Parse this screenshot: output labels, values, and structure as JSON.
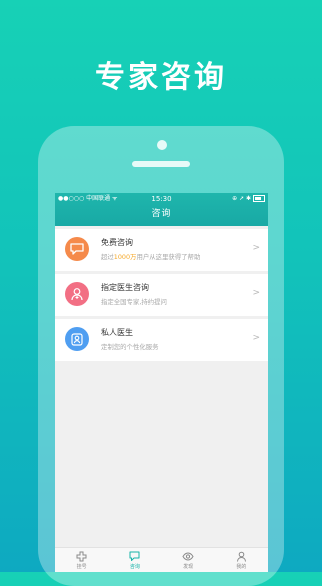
{
  "headline": "专家咨询",
  "status_bar": {
    "carrier": "●●○○○ 中国联通 ᯤ",
    "time": "15:30",
    "right_icons": "⊕ ➚ ✱"
  },
  "nav": {
    "title": "咨询"
  },
  "items": [
    {
      "title": "免费咨询",
      "sub_prefix": "超过",
      "sub_highlight": "1000万",
      "sub_suffix": "用户从这里获得了帮助",
      "icon": "chat-bubble-icon",
      "color": "#f58a4b"
    },
    {
      "title": "指定医生咨询",
      "subtitle": "指定全国专家,持约提问",
      "icon": "doctor-icon",
      "color": "#f26f84"
    },
    {
      "title": "私人医生",
      "subtitle": "定制您的个性化服务",
      "icon": "private-doctor-icon",
      "color": "#4f9ef1"
    }
  ],
  "tabs": [
    {
      "label": "挂号",
      "icon": "cross-icon",
      "active": false
    },
    {
      "label": "咨询",
      "icon": "chat-icon",
      "active": true
    },
    {
      "label": "发现",
      "icon": "eye-icon",
      "active": false
    },
    {
      "label": "我的",
      "icon": "person-icon",
      "active": false
    }
  ],
  "colors": {
    "accent": "#17b3a9",
    "highlight": "#f5a623"
  }
}
